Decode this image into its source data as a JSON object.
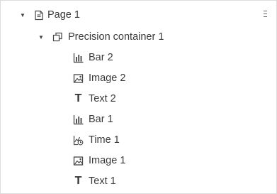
{
  "tree": {
    "page": {
      "label": "Page 1",
      "icon": "page-icon",
      "expanded": true
    },
    "container": {
      "label": "Precision container 1",
      "icon": "container-icon",
      "expanded": true
    },
    "items": [
      {
        "label": "Bar 2",
        "icon": "bar-chart-icon"
      },
      {
        "label": "Image 2",
        "icon": "image-icon"
      },
      {
        "label": "Text 2",
        "icon": "text-icon"
      },
      {
        "label": "Bar 1",
        "icon": "bar-chart-icon"
      },
      {
        "label": "Time 1",
        "icon": "time-chart-icon"
      },
      {
        "label": "Image 1",
        "icon": "image-icon"
      },
      {
        "label": "Text 1",
        "icon": "text-icon"
      }
    ]
  }
}
